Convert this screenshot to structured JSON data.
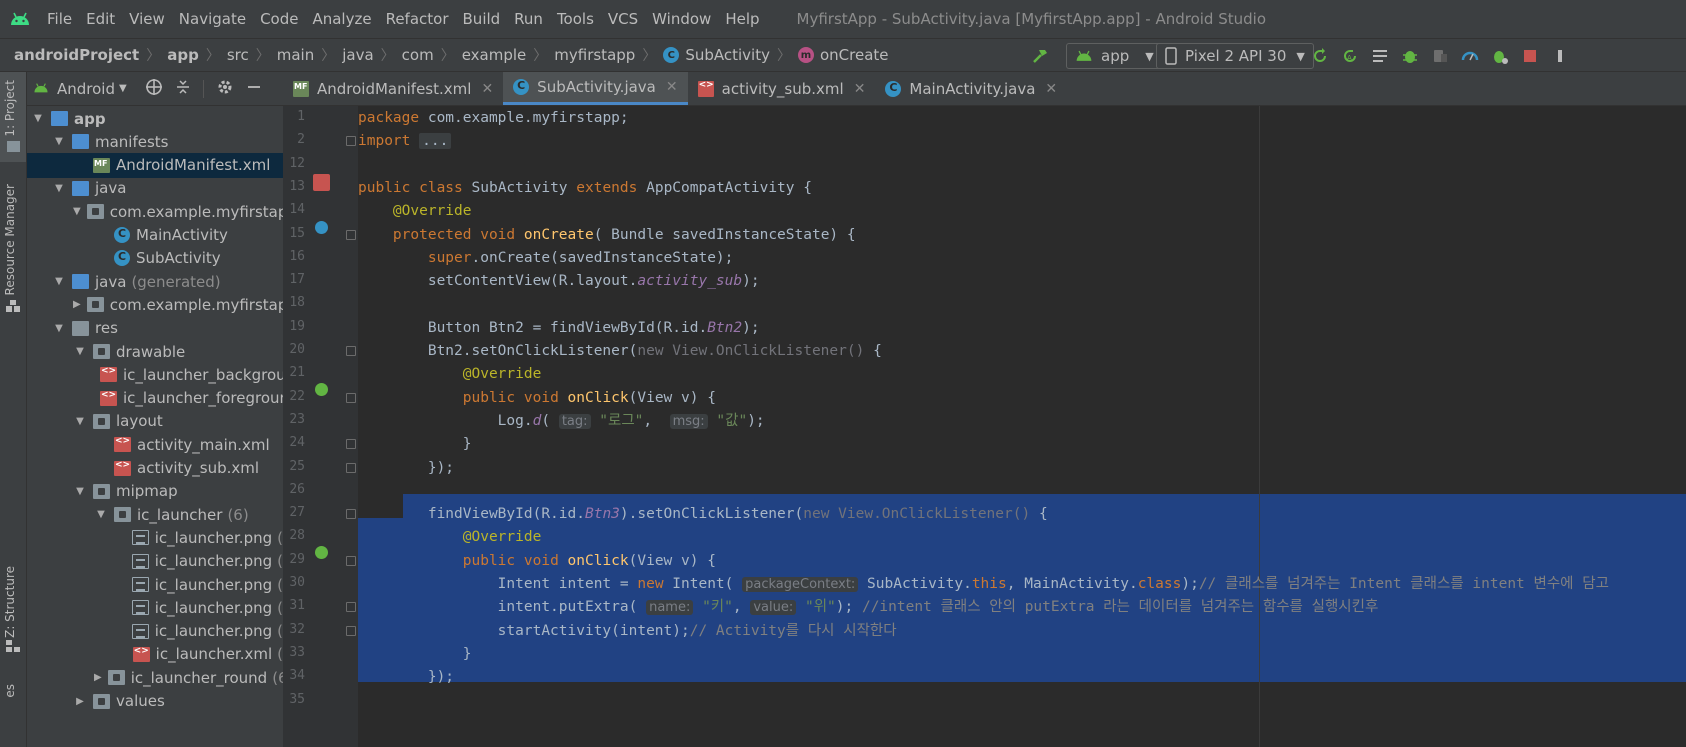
{
  "menubar": {
    "items": [
      "File",
      "Edit",
      "View",
      "Navigate",
      "Code",
      "Analyze",
      "Refactor",
      "Build",
      "Run",
      "Tools",
      "VCS",
      "Window",
      "Help"
    ],
    "title": "MyfirstApp - SubActivity.java [MyfirstApp.app] - Android Studio"
  },
  "navbar": {
    "crumbs": [
      "androidProject",
      "app",
      "src",
      "main",
      "java",
      "com",
      "example",
      "myfirstapp",
      "SubActivity",
      "onCreate"
    ],
    "run_config": "app",
    "device": "Pixel 2 API 30"
  },
  "sidebar": {
    "project_label": "1: Project",
    "resource_label": "Resource Manager",
    "structure_label": "Z: Structure",
    "bottom_label": "es"
  },
  "project": {
    "view_mode": "Android",
    "tree": [
      {
        "label": "app",
        "depth": 0,
        "arrow": "down",
        "icon": "folder-blue",
        "bold": true
      },
      {
        "label": "manifests",
        "depth": 1,
        "arrow": "down",
        "icon": "folder-blue"
      },
      {
        "label": "AndroidManifest.xml",
        "depth": 2,
        "arrow": "",
        "icon": "manifest",
        "selected": true
      },
      {
        "label": "java",
        "depth": 1,
        "arrow": "down",
        "icon": "folder-blue"
      },
      {
        "label": "com.example.myfirstapp",
        "depth": 2,
        "arrow": "down",
        "icon": "folder-pkg"
      },
      {
        "label": "MainActivity",
        "depth": 3,
        "arrow": "",
        "icon": "class"
      },
      {
        "label": "SubActivity",
        "depth": 3,
        "arrow": "",
        "icon": "class"
      },
      {
        "label": "java",
        "extra": "(generated)",
        "depth": 1,
        "arrow": "down",
        "icon": "folder-gen"
      },
      {
        "label": "com.example.myfirstapp",
        "depth": 2,
        "arrow": "right",
        "icon": "folder-pkg"
      },
      {
        "label": "res",
        "depth": 1,
        "arrow": "down",
        "icon": "folder-res"
      },
      {
        "label": "drawable",
        "depth": 2,
        "arrow": "down",
        "icon": "folder-pkg"
      },
      {
        "label": "ic_launcher_background.xml",
        "depth": 3,
        "arrow": "",
        "icon": "xml"
      },
      {
        "label": "ic_launcher_foreground.xml",
        "depth": 3,
        "arrow": "",
        "icon": "xml"
      },
      {
        "label": "layout",
        "depth": 2,
        "arrow": "down",
        "icon": "folder-pkg"
      },
      {
        "label": "activity_main.xml",
        "depth": 3,
        "arrow": "",
        "icon": "xml"
      },
      {
        "label": "activity_sub.xml",
        "depth": 3,
        "arrow": "",
        "icon": "xml"
      },
      {
        "label": "mipmap",
        "depth": 2,
        "arrow": "down",
        "icon": "folder-pkg"
      },
      {
        "label": "ic_launcher",
        "extra": "(6)",
        "depth": 3,
        "arrow": "down",
        "icon": "folder-pkg"
      },
      {
        "label": "ic_launcher.png",
        "extra": "(",
        "depth": 4,
        "arrow": "",
        "icon": "png"
      },
      {
        "label": "ic_launcher.png",
        "extra": "(",
        "depth": 4,
        "arrow": "",
        "icon": "png"
      },
      {
        "label": "ic_launcher.png",
        "extra": "(",
        "depth": 4,
        "arrow": "",
        "icon": "png"
      },
      {
        "label": "ic_launcher.png",
        "extra": "(",
        "depth": 4,
        "arrow": "",
        "icon": "png"
      },
      {
        "label": "ic_launcher.png",
        "extra": "(",
        "depth": 4,
        "arrow": "",
        "icon": "png"
      },
      {
        "label": "ic_launcher.xml",
        "extra": "(",
        "depth": 4,
        "arrow": "",
        "icon": "xml"
      },
      {
        "label": "ic_launcher_round",
        "extra": "(6",
        "depth": 3,
        "arrow": "right",
        "icon": "folder-pkg"
      },
      {
        "label": "values",
        "depth": 2,
        "arrow": "right",
        "icon": "folder-pkg"
      }
    ]
  },
  "tabs": [
    {
      "label": "AndroidManifest.xml",
      "icon": "manifest",
      "active": false
    },
    {
      "label": "SubActivity.java",
      "icon": "class",
      "active": true
    },
    {
      "label": "activity_sub.xml",
      "icon": "xml",
      "active": false
    },
    {
      "label": "MainActivity.java",
      "icon": "class",
      "active": false
    }
  ],
  "editor": {
    "lines": [
      {
        "n": "1",
        "t": [
          [
            "kw",
            "package "
          ],
          [
            "",
            "com.example.myfirstapp;"
          ]
        ]
      },
      {
        "n": "2",
        "t": [
          [
            "kw",
            "import "
          ],
          [
            "fold",
            "..."
          ]
        ]
      },
      {
        "n": "12",
        "t": []
      },
      {
        "n": "13",
        "t": [
          [
            "kw",
            "public class "
          ],
          [
            "",
            "SubActivity "
          ],
          [
            "kw",
            "extends "
          ],
          [
            "",
            "AppCompatActivity {"
          ]
        ]
      },
      {
        "n": "14",
        "t": [
          [
            "",
            "    "
          ],
          [
            "ann",
            "@Override"
          ]
        ]
      },
      {
        "n": "15",
        "t": [
          [
            "",
            "    "
          ],
          [
            "kw",
            "protected void "
          ],
          [
            "fn",
            "onCreate"
          ],
          [
            "",
            "( Bundle savedInstanceState) {"
          ]
        ]
      },
      {
        "n": "16",
        "t": [
          [
            "",
            "        "
          ],
          [
            "kw",
            "super"
          ],
          [
            "",
            ".onCreate(savedInstanceState);"
          ]
        ]
      },
      {
        "n": "17",
        "t": [
          [
            "",
            "        setContentView(R.layout."
          ],
          [
            "it",
            "activity_sub"
          ],
          [
            "",
            ");"
          ]
        ]
      },
      {
        "n": "18",
        "t": []
      },
      {
        "n": "19",
        "t": [
          [
            "",
            "        Button Btn2 = findViewById(R.id."
          ],
          [
            "it",
            "Btn2"
          ],
          [
            "",
            ");"
          ]
        ]
      },
      {
        "n": "20",
        "t": [
          [
            "",
            "        Btn2.setOnClickListener("
          ],
          [
            "gr",
            "new View.OnClickListener() "
          ],
          [
            "",
            "{"
          ]
        ]
      },
      {
        "n": "21",
        "t": [
          [
            "",
            "            "
          ],
          [
            "ann",
            "@Override"
          ]
        ]
      },
      {
        "n": "22",
        "t": [
          [
            "",
            "            "
          ],
          [
            "kw",
            "public void "
          ],
          [
            "fn",
            "onClick"
          ],
          [
            "",
            "(View v) {"
          ]
        ]
      },
      {
        "n": "23",
        "t": [
          [
            "",
            "                Log."
          ],
          [
            "it",
            "d"
          ],
          [
            "",
            "( "
          ],
          [
            "hint",
            "tag:"
          ],
          [
            "st",
            " \"로그\""
          ],
          [
            "",
            ",  "
          ],
          [
            "hint",
            "msg:"
          ],
          [
            "st",
            " \"값\""
          ],
          [
            "",
            ");"
          ]
        ]
      },
      {
        "n": "24",
        "t": [
          [
            "",
            "            }"
          ]
        ]
      },
      {
        "n": "25",
        "t": [
          [
            "",
            "        });"
          ]
        ]
      },
      {
        "n": "26",
        "t": []
      },
      {
        "n": "27",
        "t": [
          [
            "",
            "        findViewById(R.id."
          ],
          [
            "it",
            "Btn3"
          ],
          [
            "",
            ").setOnClickListener("
          ],
          [
            "gr",
            "new View.OnClickListener() "
          ],
          [
            "",
            "{"
          ]
        ]
      },
      {
        "n": "28",
        "t": [
          [
            "",
            "            "
          ],
          [
            "ann",
            "@Override"
          ]
        ]
      },
      {
        "n": "29",
        "t": [
          [
            "",
            "            "
          ],
          [
            "kw",
            "public void "
          ],
          [
            "fn",
            "onClick"
          ],
          [
            "",
            "(View v) {"
          ]
        ]
      },
      {
        "n": "30",
        "t": [
          [
            "",
            "                Intent intent = "
          ],
          [
            "kw",
            "new "
          ],
          [
            "",
            "Intent( "
          ],
          [
            "hint",
            "packageContext:"
          ],
          [
            "",
            " SubActivity."
          ],
          [
            "kw",
            "this"
          ],
          [
            "",
            ", MainActivity."
          ],
          [
            "kw",
            "class"
          ],
          [
            "",
            ");"
          ],
          [
            "cm",
            "// 클래스를 넘겨주는 Intent 클래스를 intent 변수에 담고"
          ]
        ]
      },
      {
        "n": "31",
        "t": [
          [
            "",
            "                intent.putExtra( "
          ],
          [
            "hint",
            "name:"
          ],
          [
            "st",
            " \"키\""
          ],
          [
            "",
            ", "
          ],
          [
            "hint",
            "value:"
          ],
          [
            "st",
            " \"위\""
          ],
          [
            "",
            "); "
          ],
          [
            "cm",
            "//intent 클래스 안의 putExtra 라는 데이터를 넘겨주는 함수를 실행시킨후"
          ]
        ]
      },
      {
        "n": "32",
        "t": [
          [
            "",
            "                startActivity(intent);"
          ],
          [
            "cm",
            "// Activity를 다시 시작한다"
          ]
        ]
      },
      {
        "n": "33",
        "t": [
          [
            "",
            "            }"
          ]
        ]
      },
      {
        "n": "34",
        "t": [
          [
            "",
            "        });"
          ]
        ]
      },
      {
        "n": "35",
        "t": []
      }
    ]
  }
}
